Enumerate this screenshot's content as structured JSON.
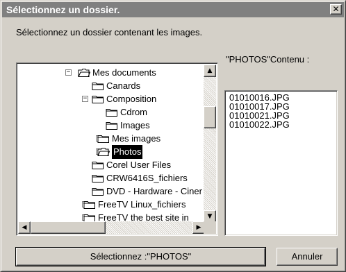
{
  "window": {
    "title": "Sélectionnez un dossier.",
    "close_glyph": "✕"
  },
  "instruction": "Sélectionnez un dossier contenant les images.",
  "contents_label": "\"PHOTOS\"Contenu :",
  "tree": {
    "items": [
      {
        "label": "Mes documents",
        "expander": "⊟",
        "icon": "open-folder-icon"
      },
      {
        "label": "Canards",
        "expander": "",
        "icon": "folder-icon"
      },
      {
        "label": "Composition",
        "expander": "⊟",
        "icon": "folder-icon"
      },
      {
        "label": "Cdrom",
        "expander": "",
        "icon": "folder-icon"
      },
      {
        "label": "Images",
        "expander": "",
        "icon": "folder-icon"
      },
      {
        "label": "Mes images",
        "expander": "⊞",
        "icon": "folder-icon"
      },
      {
        "label": "Photos",
        "expander": "⊞",
        "icon": "open-folder-icon",
        "selected": true
      },
      {
        "label": "Corel User Files",
        "expander": "",
        "icon": "folder-icon"
      },
      {
        "label": "CRW6416S_fichiers",
        "expander": "",
        "icon": "folder-icon"
      },
      {
        "label": "DVD - Hardware - Ciner",
        "expander": "",
        "icon": "folder-icon"
      },
      {
        "label": "FreeTV Linux_fichiers",
        "expander": "⊞",
        "icon": "folder-icon"
      },
      {
        "label": "FreeTV the best site in",
        "expander": "⊞",
        "icon": "folder-icon"
      }
    ]
  },
  "files": [
    "01010016.JPG",
    "01010017.JPG",
    "01010021.JPG",
    "01010022.JPG"
  ],
  "buttons": {
    "select": "Sélectionnez :\"PHOTOS\"",
    "cancel": "Annuler"
  },
  "scroll_glyphs": {
    "up": "▲",
    "down": "▼",
    "left": "◀",
    "right": "▶"
  }
}
